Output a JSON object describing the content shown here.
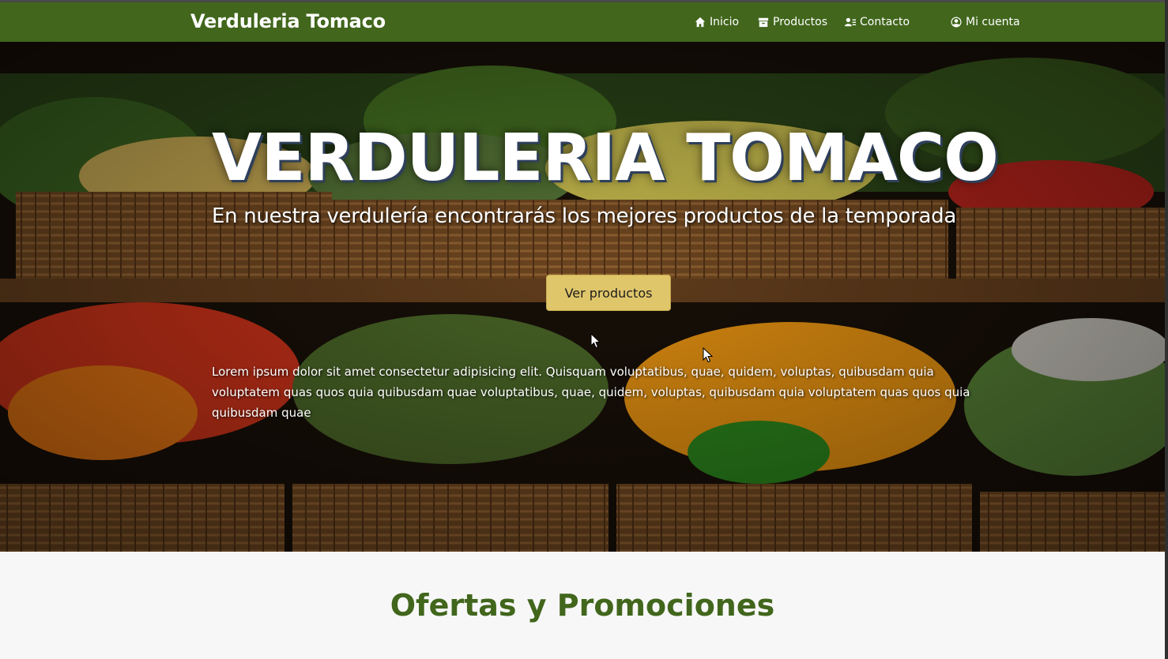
{
  "navbar": {
    "brand": "Verduleria Tomaco",
    "items": [
      {
        "label": "Inicio",
        "icon": "home-icon"
      },
      {
        "label": "Productos",
        "icon": "archive-box-icon"
      },
      {
        "label": "Contacto",
        "icon": "contact-list-icon"
      },
      {
        "label": "Mi cuenta",
        "icon": "user-circle-icon"
      }
    ]
  },
  "hero": {
    "title": "VERDULERIA TOMACO",
    "subtitle": "En nuestra verdulería encontrarás los mejores productos de la temporada",
    "button_label": "Ver productos",
    "body_text": "Lorem ipsum dolor sit amet consectetur adipisicing elit. Quisquam voluptatibus, quae, quidem, voluptas, quibusdam quia voluptatem quas quos quia quibusdam quae voluptatibus, quae, quidem, voluptas, quibusdam quia voluptatem quas quos quia quibusdam quae"
  },
  "offers": {
    "title": "Ofertas y Promociones"
  },
  "colors": {
    "navbar": "#41661c",
    "button": "#e0c66b",
    "section_title": "#41661c"
  }
}
